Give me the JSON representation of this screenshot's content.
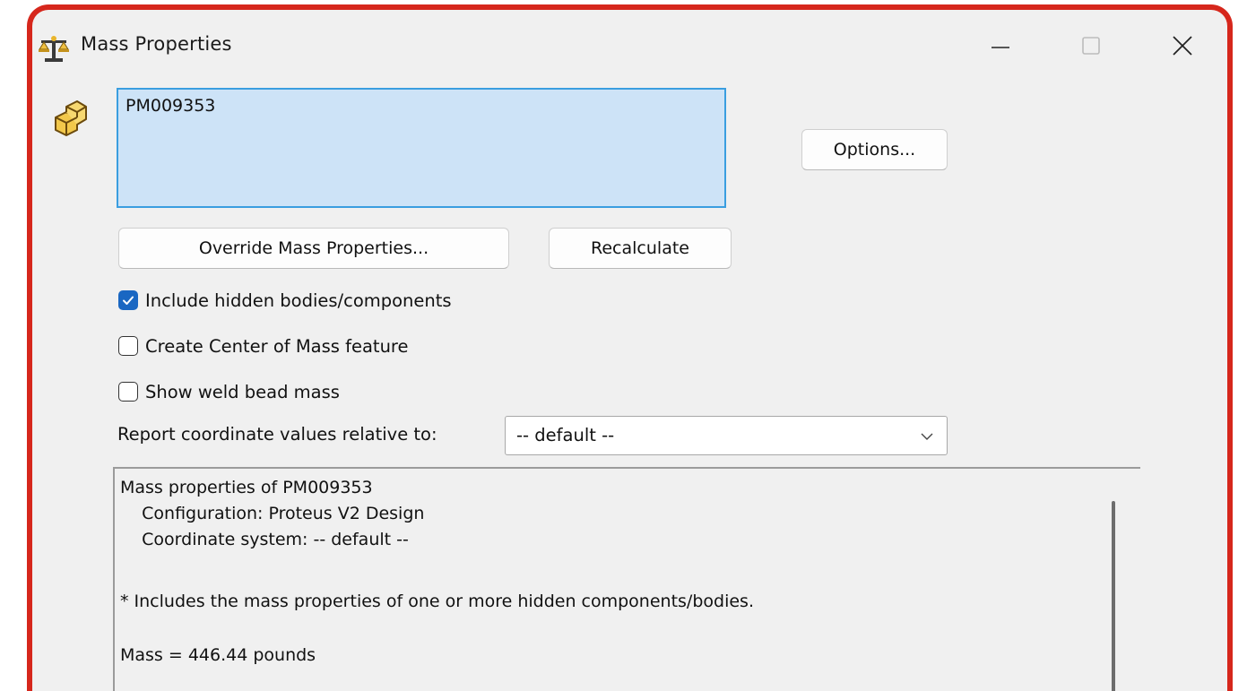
{
  "window": {
    "title": "Mass Properties",
    "icon": "scale-icon",
    "controls": {
      "minimize": "minimize-icon",
      "maximize": "maximize-icon",
      "close": "close-icon"
    }
  },
  "selection": {
    "icon": "part-icon",
    "items": [
      "PM009353"
    ],
    "highlight_color": "#cde3f7",
    "border_color": "#3a9ee0"
  },
  "buttons": {
    "options": "Options...",
    "override": "Override Mass Properties...",
    "recalculate": "Recalculate"
  },
  "checkboxes": [
    {
      "label": "Include hidden bodies/components",
      "checked": true
    },
    {
      "label": "Create Center of Mass feature",
      "checked": false
    },
    {
      "label": "Show weld bead mass",
      "checked": false
    }
  ],
  "report": {
    "label": "Report coordinate values relative to:",
    "selected": "-- default --"
  },
  "results": {
    "lines": [
      "Mass properties of PM009353",
      "    Configuration: Proteus V2 Design",
      "    Coordinate system: -- default --",
      "",
      "* Includes the mass properties of one or more hidden components/bodies.",
      "",
      "Mass = 446.44 pounds"
    ]
  },
  "colors": {
    "frame_highlight": "#d6271c",
    "dialog_bg": "#f0f0f0",
    "checkbox_accent": "#1a67c2"
  }
}
